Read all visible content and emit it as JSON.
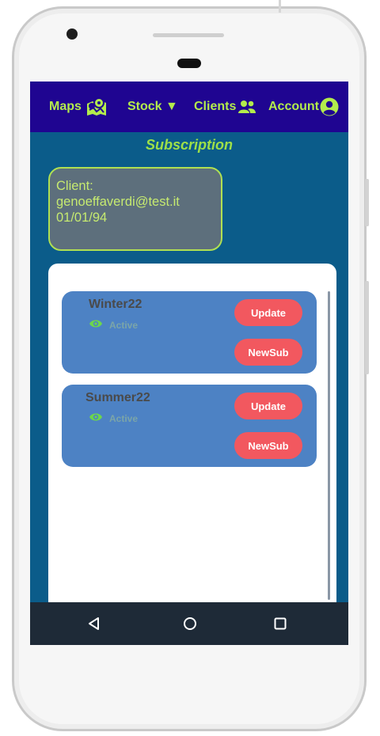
{
  "navbar": {
    "items": [
      {
        "label": "Maps",
        "icon": "map-marked-icon"
      },
      {
        "label": "Stock ▼",
        "icon": ""
      },
      {
        "label": "Clients",
        "icon": "users-icon"
      },
      {
        "label": "Account",
        "icon": "user-circle-icon"
      }
    ]
  },
  "page": {
    "title": "Subscription"
  },
  "client": {
    "label": "Client:",
    "email": "genoeffaverdi@test.it",
    "date": "01/01/94"
  },
  "subscriptions": [
    {
      "name": "Winter22",
      "status": "Active",
      "update_label": "Update",
      "newsub_label": "NewSub"
    },
    {
      "name": "Summer22",
      "status": "Active",
      "update_label": "Update",
      "newsub_label": "NewSub"
    }
  ],
  "colors": {
    "navbar": "#1f0591",
    "accent": "#b3ec4c",
    "screen": "#0b5c8a",
    "card": "#4d82c4",
    "button": "#f2585f"
  },
  "android_nav": {
    "icons": [
      "back-icon",
      "home-icon",
      "recents-icon"
    ]
  }
}
